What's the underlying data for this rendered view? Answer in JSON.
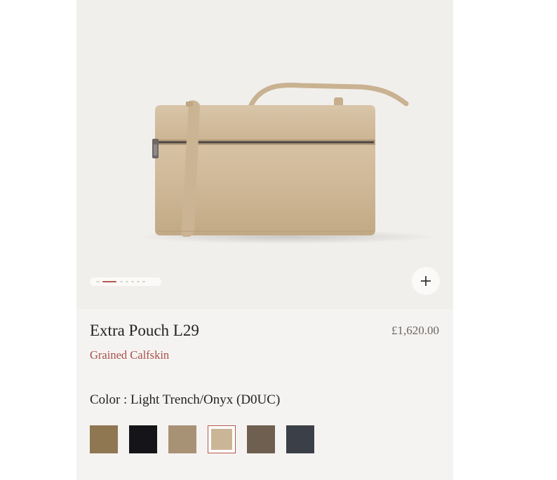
{
  "product": {
    "name": "Extra Pouch L29",
    "material": "Grained Calfskin",
    "price": "£1,620.00",
    "color_label": "Color : Light Trench/Onyx (D0UC)"
  },
  "gallery": {
    "image_subject": "Extra Pouch L29 in Light Trench",
    "zoom_icon": "plus-icon",
    "slide_count": 7,
    "active_slide": 2
  },
  "swatches": [
    {
      "name": "swatch-1",
      "color": "#8f7752",
      "selected": false
    },
    {
      "name": "swatch-2",
      "color": "#151418",
      "selected": false
    },
    {
      "name": "swatch-3",
      "color": "#a89276",
      "selected": false
    },
    {
      "name": "swatch-4",
      "color": "#cbb597",
      "selected": true
    },
    {
      "name": "swatch-5",
      "color": "#6f5f50",
      "selected": false
    },
    {
      "name": "swatch-6",
      "color": "#3b4048",
      "selected": false
    }
  ],
  "colors": {
    "accent": "#b4574e",
    "material_text": "#a8504a",
    "card_background": "#f5f3f1"
  }
}
